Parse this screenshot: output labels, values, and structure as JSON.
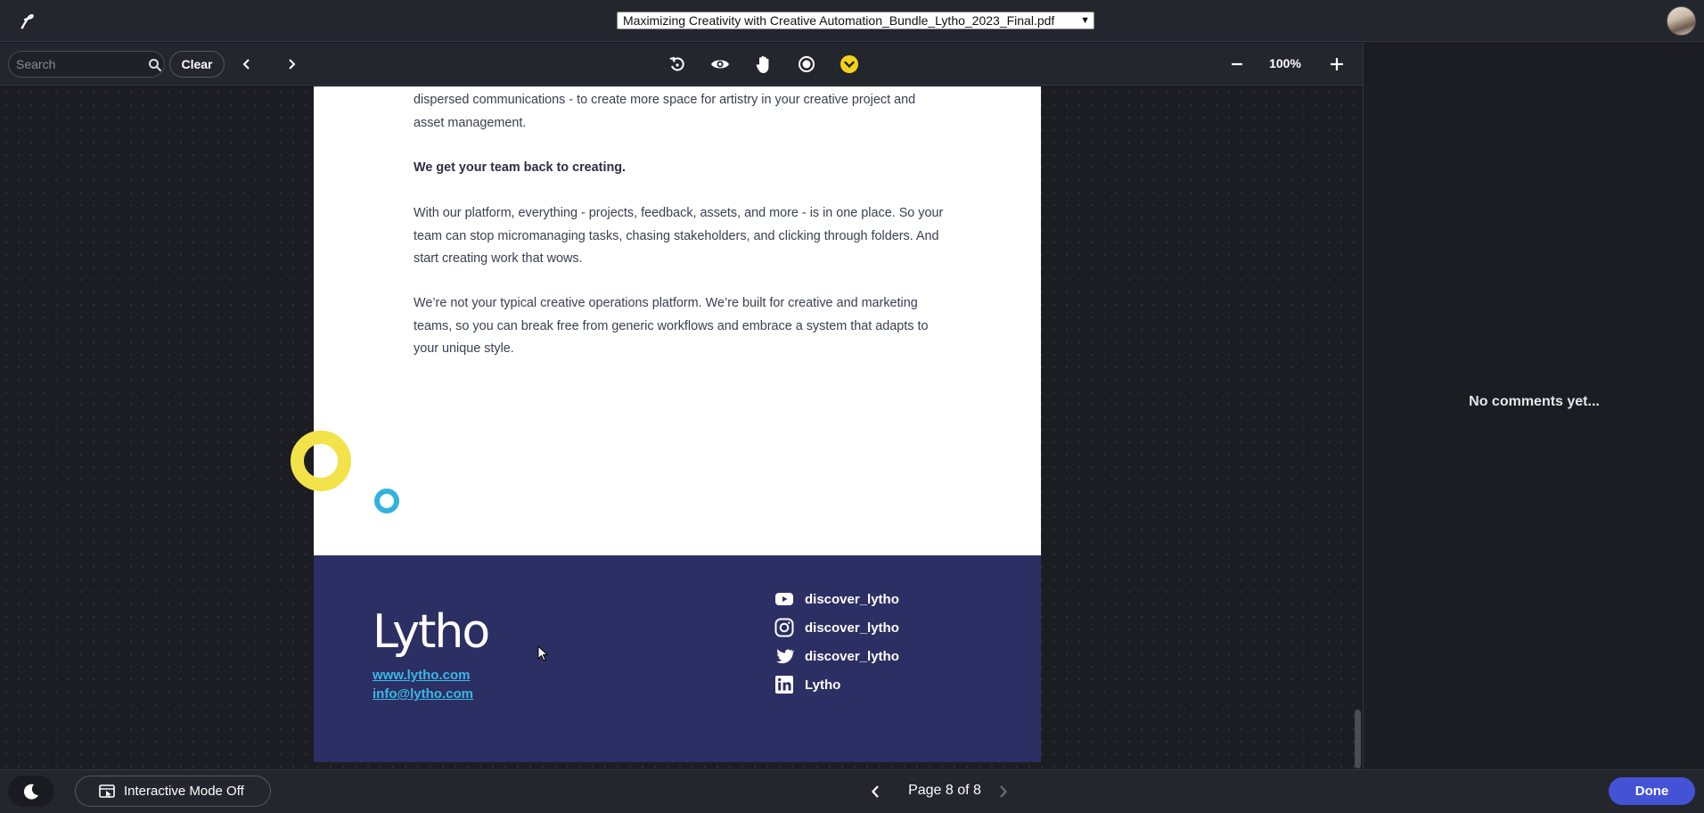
{
  "header": {
    "file_name": "Maximizing Creativity with Creative Automation_Bundle_Lytho_2023_Final.pdf"
  },
  "toolbar": {
    "search_placeholder": "Search",
    "clear_label": "Clear",
    "zoom_level": "100%",
    "tools": [
      "rotate-icon",
      "eye-icon",
      "hand-icon",
      "record-icon",
      "chevron-circle-icon"
    ]
  },
  "document": {
    "paragraphs": [
      "dispersed communications - to create more space for artistry in your creative project and asset management.",
      "We get your team back to creating.",
      "With our platform, everything - projects, feedback, assets, and more - is in one place. So your team can stop micromanaging tasks, chasing stakeholders, and clicking through folders. And start creating work that wows.",
      "We’re not your typical creative operations platform. We’re built for creative and marketing teams, so you can break free from generic workflows and embrace a system that adapts to your unique style."
    ],
    "footer": {
      "brand": "Lytho",
      "website": "www.lytho.com",
      "email": "info@lytho.com",
      "social": [
        {
          "icon": "youtube-icon",
          "handle": "discover_lytho"
        },
        {
          "icon": "instagram-icon",
          "handle": "discover_lytho"
        },
        {
          "icon": "twitter-icon",
          "handle": "discover_lytho"
        },
        {
          "icon": "linkedin-icon",
          "handle": "Lytho"
        }
      ]
    }
  },
  "comments": {
    "empty_text": "No comments yet..."
  },
  "bottom": {
    "mode_label": "Interactive Mode Off",
    "page_indicator": "Page 8 of 8",
    "done_label": "Done"
  },
  "colors": {
    "accent": "#4453d6",
    "footer_bg": "#2c2f63",
    "link": "#3ab8e6",
    "highlight": "#f3e34b"
  }
}
